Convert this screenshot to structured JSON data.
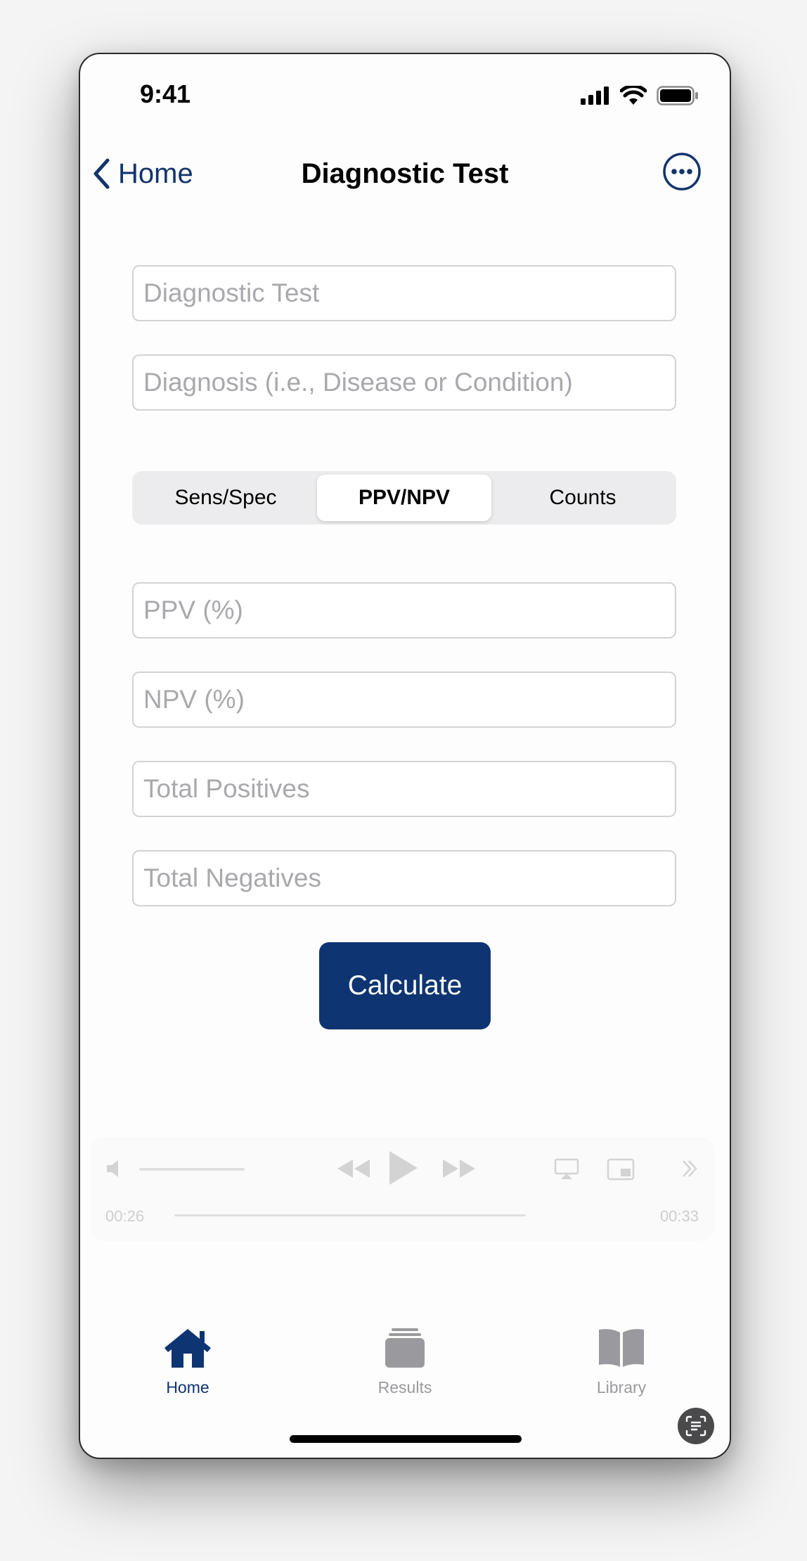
{
  "status_bar": {
    "time": "9:41"
  },
  "nav": {
    "back_label": "Home",
    "title": "Diagnostic Test"
  },
  "form": {
    "test_placeholder": "Diagnostic Test",
    "diagnosis_placeholder": "Diagnosis (i.e., Disease or Condition)",
    "ppv_placeholder": "PPV (%)",
    "npv_placeholder": "NPV (%)",
    "total_positives_placeholder": "Total Positives",
    "total_negatives_placeholder": "Total Negatives"
  },
  "segments": [
    {
      "label": "Sens/Spec",
      "selected": false
    },
    {
      "label": "PPV/NPV",
      "selected": true
    },
    {
      "label": "Counts",
      "selected": false
    }
  ],
  "calculate_label": "Calculate",
  "media": {
    "elapsed": "00:26",
    "remaining": "00:33"
  },
  "tabs": [
    {
      "label": "Home",
      "icon": "house-icon",
      "selected": true
    },
    {
      "label": "Results",
      "icon": "stack-icon",
      "selected": false
    },
    {
      "label": "Library",
      "icon": "book-icon",
      "selected": false
    }
  ],
  "colors": {
    "accent": "#0e3472",
    "inactive": "#9a9a9e"
  }
}
